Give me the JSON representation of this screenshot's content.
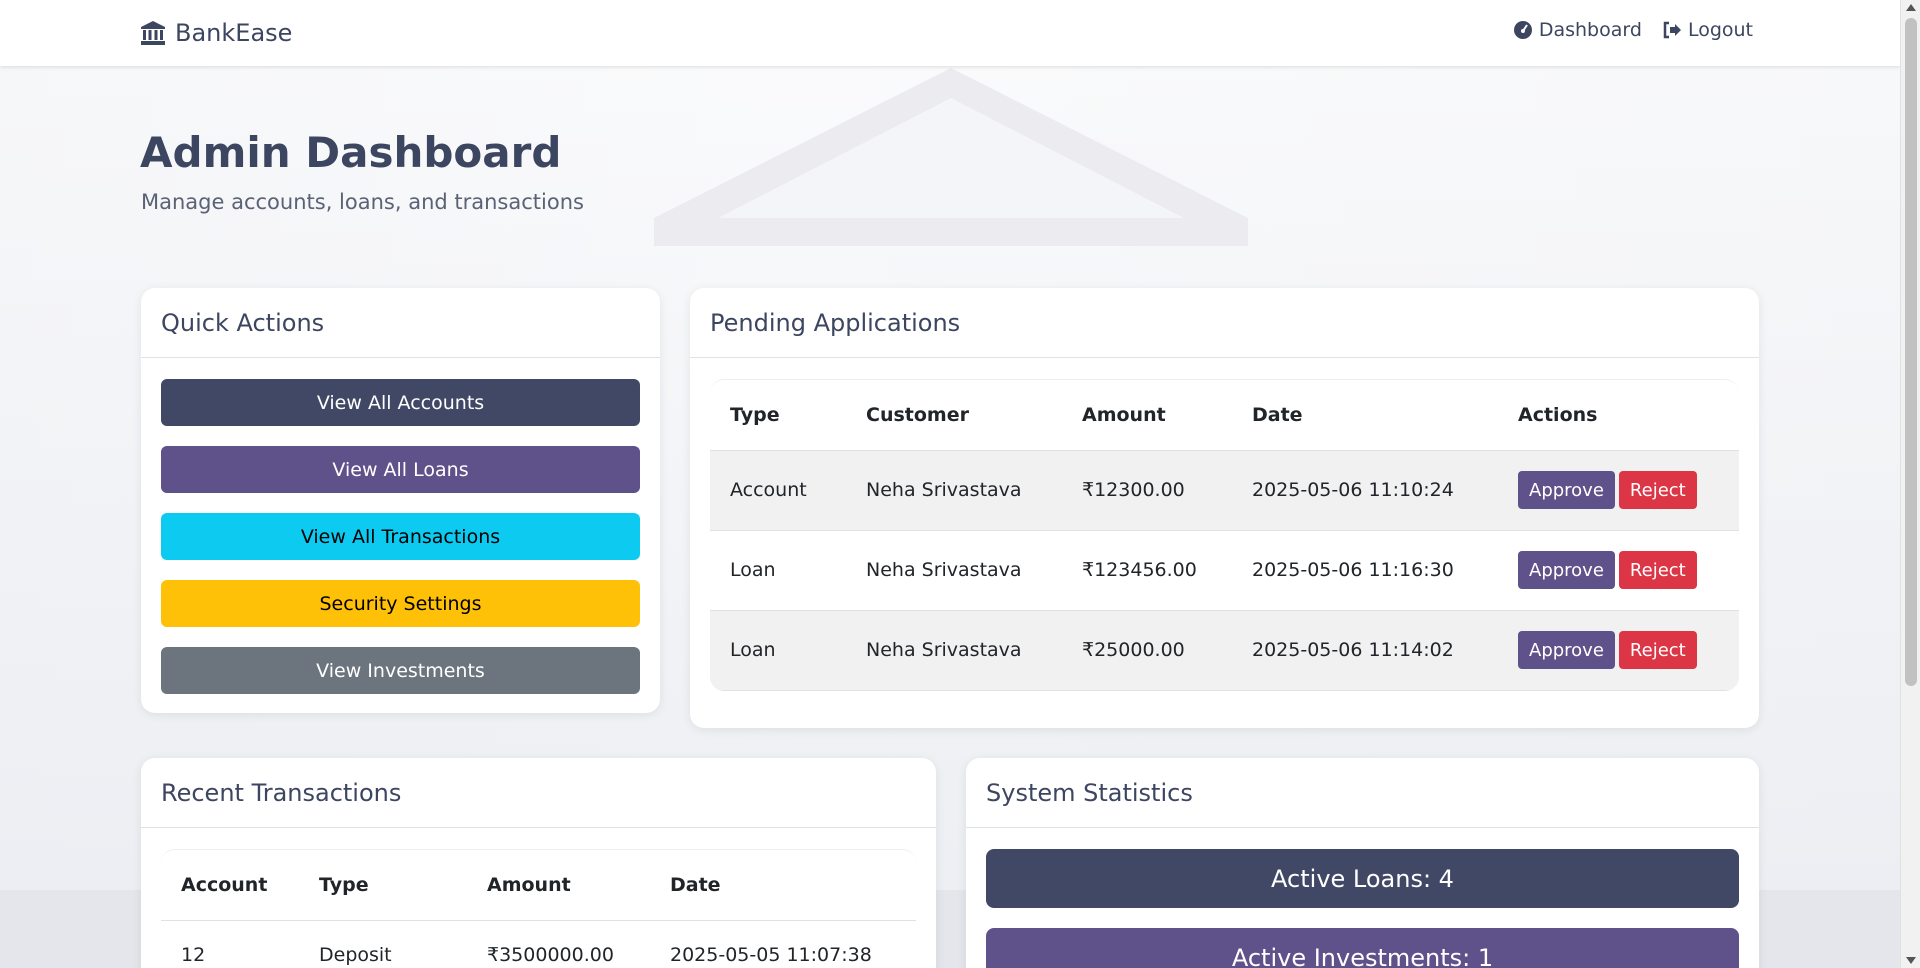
{
  "navbar": {
    "brand": "BankEase",
    "links": [
      {
        "label": "Dashboard",
        "icon": "tachometer-icon"
      },
      {
        "label": "Logout",
        "icon": "sign-out-icon"
      }
    ]
  },
  "header": {
    "title": "Admin Dashboard",
    "subtitle": "Manage accounts, loans, and transactions"
  },
  "quick_actions": {
    "title": "Quick Actions",
    "buttons": [
      {
        "label": "View All Accounts",
        "color": "#414866"
      },
      {
        "label": "View All Loans",
        "color": "#5f5189"
      },
      {
        "label": "View All Transactions",
        "color": "#0dcaf0"
      },
      {
        "label": "Security Settings",
        "color": "#ffc107"
      },
      {
        "label": "View Investments",
        "color": "#6c757d"
      }
    ]
  },
  "pending_applications": {
    "title": "Pending Applications",
    "columns": [
      "Type",
      "Customer",
      "Amount",
      "Date",
      "Actions"
    ],
    "rows": [
      {
        "type": "Account",
        "customer": "Neha Srivastava",
        "amount": "₹12300.00",
        "date": "2025-05-06 11:10:24"
      },
      {
        "type": "Loan",
        "customer": "Neha Srivastava",
        "amount": "₹123456.00",
        "date": "2025-05-06 11:16:30"
      },
      {
        "type": "Loan",
        "customer": "Neha Srivastava",
        "amount": "₹25000.00",
        "date": "2025-05-06 11:14:02"
      }
    ],
    "approve_label": "Approve",
    "reject_label": "Reject"
  },
  "recent_transactions": {
    "title": "Recent Transactions",
    "columns": [
      "Account",
      "Type",
      "Amount",
      "Date"
    ],
    "rows": [
      {
        "account": "12",
        "type": "Deposit",
        "amount": "₹3500000.00",
        "date": "2025-05-05 11:07:38"
      }
    ]
  },
  "system_statistics": {
    "title": "System Statistics",
    "active_loans": "Active Loans: 4",
    "active_investments": "Active Investments: 1"
  },
  "colors": {
    "primary": "#414866",
    "purple": "#5f5189",
    "danger": "#dc3545",
    "info": "#0dcaf0",
    "warning": "#ffc107",
    "secondary": "#6c757d"
  }
}
